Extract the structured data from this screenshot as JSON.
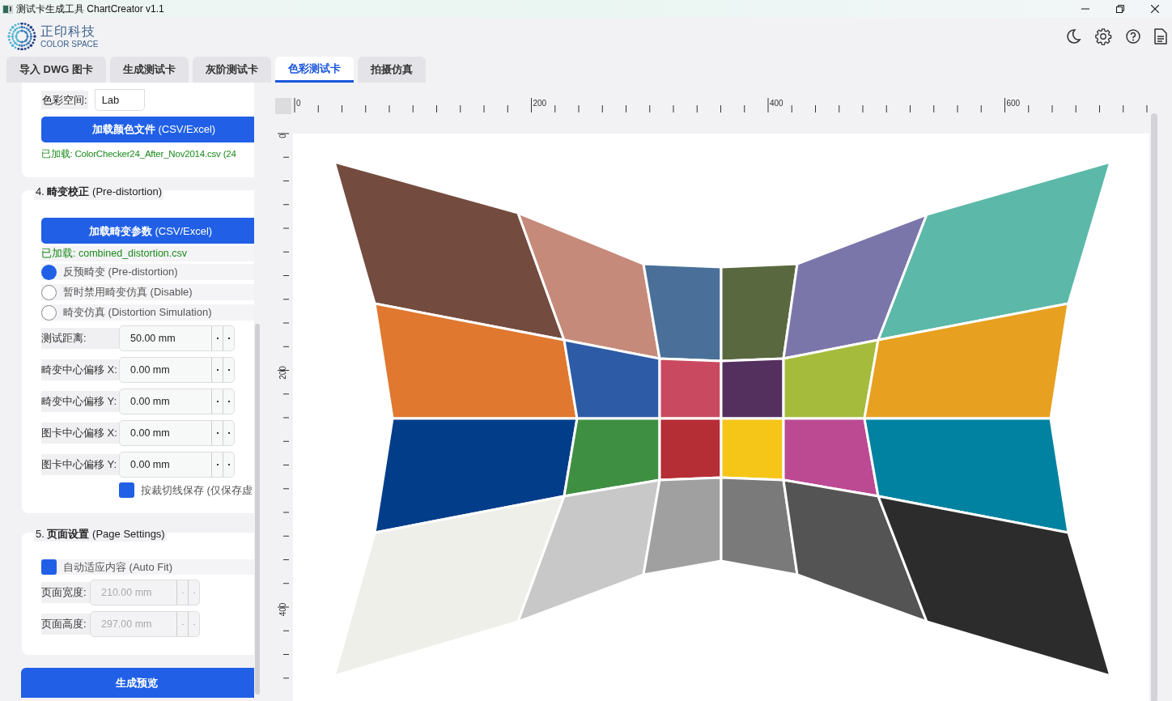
{
  "window": {
    "title": "测试卡生成工具 ChartCreator v1.1"
  },
  "header": {
    "logo_name": "正印科技",
    "logo_subtitle": "COLOR SPACE"
  },
  "tabs": [
    {
      "label": "导入 DWG 图卡",
      "selected": false
    },
    {
      "label": "生成测试卡",
      "selected": false
    },
    {
      "label": "灰阶测试卡",
      "selected": false
    },
    {
      "label": "色彩测试卡",
      "selected": true
    },
    {
      "label": "拍摄仿真",
      "selected": false
    }
  ],
  "color_section": {
    "color_space_label": "色彩空间:",
    "color_space_value": "Lab",
    "load_button": "**加载颜色文件** (CSV/Excel)",
    "loaded_text": "已加载: ColorChecker24_After_Nov2014.csv (24"
  },
  "distortion_section": {
    "title": "4. **畸变校正** (Pre-distortion)",
    "load_button": "**加载畸变参数** (CSV/Excel)",
    "loaded_text": "已加载: combined_distortion.csv",
    "modes": [
      {
        "label": "反预畸变 (Pre-distortion)",
        "selected": true
      },
      {
        "label": "暂时禁用畸变仿真 (Disable)",
        "selected": false
      },
      {
        "label": "畸变仿真 (Distortion Simulation)",
        "selected": false
      }
    ],
    "fields": [
      {
        "label": "测试距离:",
        "value": "50.00 mm"
      },
      {
        "label": "畸变中心偏移 X:",
        "value": "0.00 mm"
      },
      {
        "label": "畸变中心偏移 Y:",
        "value": "0.00 mm"
      },
      {
        "label": "图卡中心偏移 X:",
        "value": "0.00 mm"
      },
      {
        "label": "图卡中心偏移 Y:",
        "value": "0.00 mm"
      }
    ],
    "save_option": {
      "label": "按裁切线保存 (仅保存虚",
      "checked": true
    }
  },
  "page_section": {
    "title": "5. **页面设置** (Page Settings)",
    "auto_fit": {
      "label": "自动适应内容 (Auto Fit)",
      "checked": true
    },
    "fields": [
      {
        "label": "页面宽度:",
        "value": "210.00 mm",
        "disabled": true
      },
      {
        "label": "页面高度:",
        "value": "297.00 mm",
        "disabled": true
      }
    ]
  },
  "generate_button": "生成预览",
  "rulers": {
    "top_labels": [
      "0",
      "200",
      "400",
      "600"
    ],
    "left_labels": [
      "0",
      "200",
      "400"
    ]
  },
  "patches": [
    {
      "color": "#744b3f"
    },
    {
      "color": "#c68a7a"
    },
    {
      "color": "#4a7099"
    },
    {
      "color": "#5a6840"
    },
    {
      "color": "#7b76aa"
    },
    {
      "color": "#5cb8a8"
    },
    {
      "color": "#e07830"
    },
    {
      "color": "#2d5ba5"
    },
    {
      "color": "#c94a60"
    },
    {
      "color": "#54305f"
    },
    {
      "color": "#a5bb3c"
    },
    {
      "color": "#e8a020"
    },
    {
      "color": "#023d8a"
    },
    {
      "color": "#3f8f43"
    },
    {
      "color": "#b52d35"
    },
    {
      "color": "#f5c518"
    },
    {
      "color": "#bb4a93"
    },
    {
      "color": "#0082a0"
    },
    {
      "color": "#efefea"
    },
    {
      "color": "#c8c8c8"
    },
    {
      "color": "#a0a0a0"
    },
    {
      "color": "#7a7a7a"
    },
    {
      "color": "#545454"
    },
    {
      "color": "#2c2c2c"
    }
  ]
}
